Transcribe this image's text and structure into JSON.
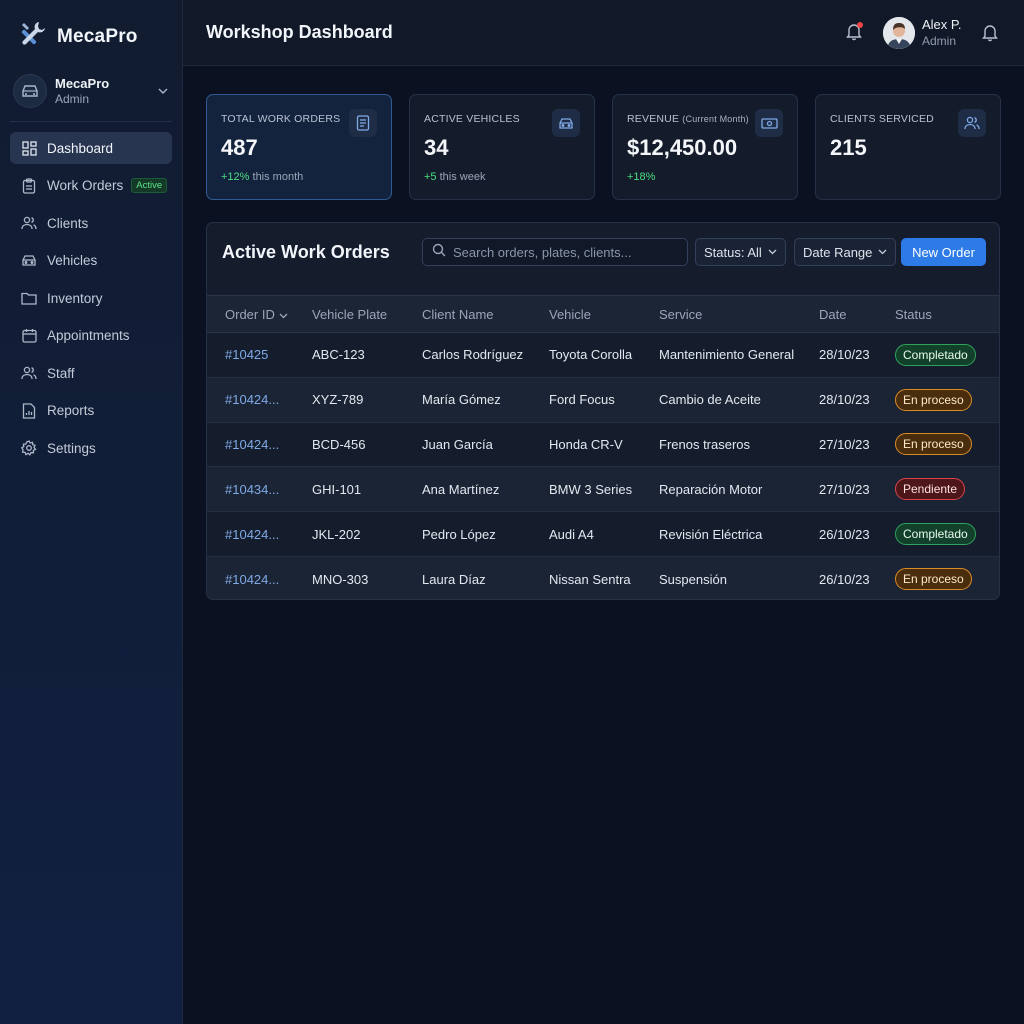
{
  "app": {
    "brand": "MecaPro",
    "account_name": "MecaPro",
    "account_role": "Admin"
  },
  "sidebar": {
    "items": [
      {
        "label": "Dashboard",
        "icon": "dashboard-icon",
        "active": true
      },
      {
        "label": "Work Orders",
        "icon": "clipboard-icon",
        "badge": "Active"
      },
      {
        "label": "Clients",
        "icon": "users-icon"
      },
      {
        "label": "Vehicles",
        "icon": "car-icon"
      },
      {
        "label": "Inventory",
        "icon": "folder-icon"
      },
      {
        "label": "Appointments",
        "icon": "calendar-icon"
      },
      {
        "label": "Staff",
        "icon": "users-icon"
      },
      {
        "label": "Reports",
        "icon": "report-icon"
      },
      {
        "label": "Settings",
        "icon": "gear-icon"
      }
    ]
  },
  "header": {
    "title": "Workshop Dashboard",
    "user_name": "Alex P.",
    "user_role": "Admin"
  },
  "kpis": [
    {
      "label": "TOTAL WORK ORDERS",
      "label_note": "",
      "value": "487",
      "delta": "+12%",
      "delta_text": " this month",
      "icon": "document-icon"
    },
    {
      "label": "ACTIVE VEHICLES",
      "label_note": "",
      "value": "34",
      "delta": "+5",
      "delta_text": " this week",
      "icon": "car-icon"
    },
    {
      "label": "REVENUE",
      "label_note": "(Current Month)",
      "value": "$12,450.00",
      "delta": "+18%",
      "delta_text": "",
      "icon": "money-icon"
    },
    {
      "label": "CLIENTS SERVICED",
      "label_note": "",
      "value": "215",
      "delta": "",
      "delta_text": "",
      "icon": "users-icon"
    }
  ],
  "orders": {
    "title": "Active Work Orders",
    "search_placeholder": "Search orders, plates, clients...",
    "status_filter": "Status: All",
    "date_filter": "Date Range",
    "new_button": "New Order",
    "columns": [
      "Order ID",
      "Vehicle Plate",
      "Client Name",
      "Vehicle",
      "Service",
      "Date",
      "Status"
    ],
    "rows": [
      {
        "id": "#10425",
        "plate": "ABC-123",
        "client": "Carlos Rodríguez",
        "vehicle": "Toyota Corolla",
        "service": "Mantenimiento General",
        "date": "28/10/23",
        "status": "Completado",
        "status_kind": "done"
      },
      {
        "id": "#10424...",
        "plate": "XYZ-789",
        "client": "María Gómez",
        "vehicle": "Ford Focus",
        "service": "Cambio de Aceite",
        "date": "28/10/23",
        "status": "En proceso",
        "status_kind": "prog"
      },
      {
        "id": "#10424...",
        "plate": "BCD-456",
        "client": "Juan García",
        "vehicle": "Honda CR-V",
        "service": "Frenos traseros",
        "date": "27/10/23",
        "status": "En proceso",
        "status_kind": "prog"
      },
      {
        "id": "#10434...",
        "plate": "GHI-101",
        "client": "Ana Martínez",
        "vehicle": "BMW 3 Series",
        "service": "Reparación Motor",
        "date": "27/10/23",
        "status": "Pendiente",
        "status_kind": "pend"
      },
      {
        "id": "#10424...",
        "plate": "JKL-202",
        "client": "Pedro López",
        "vehicle": "Audi A4",
        "service": "Revisión Eléctrica",
        "date": "26/10/23",
        "status": "Completado",
        "status_kind": "done"
      },
      {
        "id": "#10424...",
        "plate": "MNO-303",
        "client": "Laura Díaz",
        "vehicle": "Nissan Sentra",
        "service": "Suspensión",
        "date": "26/10/23",
        "status": "En proceso",
        "status_kind": "prog"
      }
    ]
  },
  "colors": {
    "accent": "#2d7be6",
    "positive": "#4ade80",
    "completed": "#2fa35e",
    "in_progress": "#d98b26",
    "pending": "#d9434b"
  }
}
